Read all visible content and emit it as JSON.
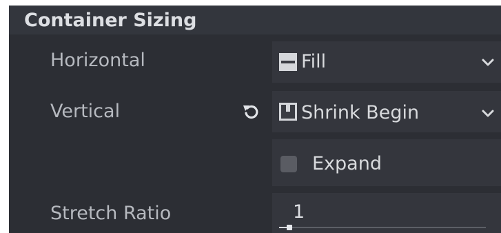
{
  "section": {
    "title": "Container Sizing"
  },
  "rows": {
    "horizontal": {
      "label": "Horizontal",
      "value": "Fill",
      "icon": "fill-icon",
      "dropdown_icon": "chevron-down-icon"
    },
    "vertical": {
      "label": "Vertical",
      "value": "Shrink Begin",
      "icon": "shrink-begin-icon",
      "revert_icon": "revert-icon",
      "dropdown_icon": "chevron-down-icon"
    },
    "expand": {
      "label": "Expand",
      "checked": false
    },
    "stretch_ratio": {
      "label": "Stretch Ratio",
      "value": "1",
      "slider_fraction": 0.05
    }
  },
  "colors": {
    "panel_bg": "#2c2e34",
    "header_bg": "#33363d",
    "field_bg": "#34363d",
    "text": "#b6b9bf",
    "value_text": "#d8dadd",
    "checkbox": "#5a5c63"
  }
}
